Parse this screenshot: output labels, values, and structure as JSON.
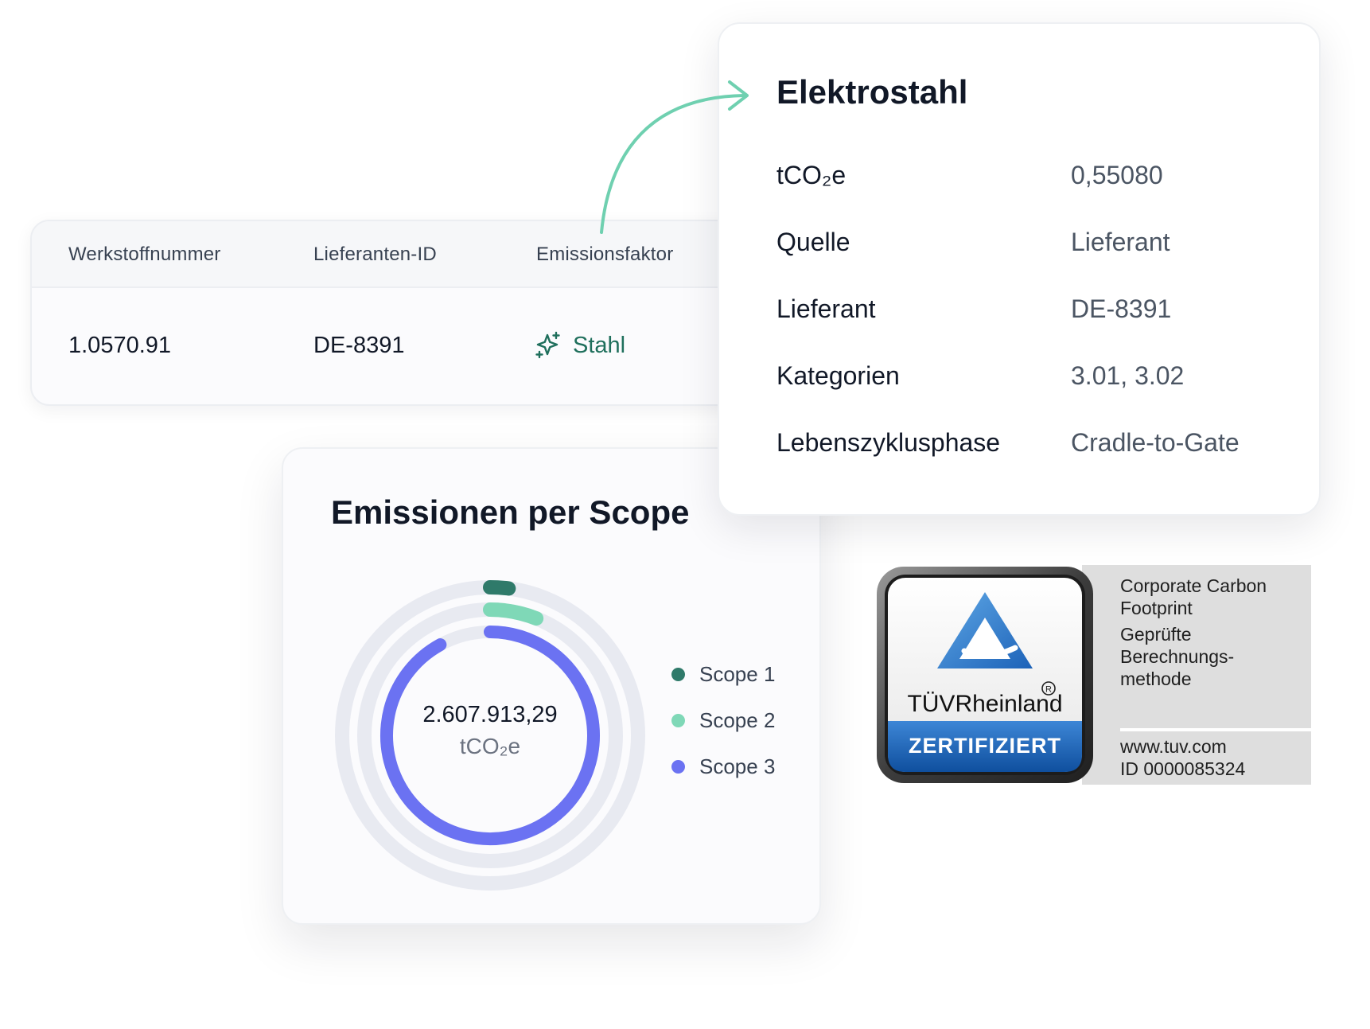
{
  "table": {
    "headers": [
      "Werkstoffnummer",
      "Lieferanten-ID",
      "Emissionsfaktor"
    ],
    "row": {
      "werkstoffnummer": "1.0570.91",
      "lieferanten_id": "DE-8391",
      "emissionsfaktor": "Stahl"
    },
    "icon": "sparkle-icon"
  },
  "detail": {
    "title": "Elektrostahl",
    "rows": [
      {
        "label": "tCO₂e",
        "value": "0,55080"
      },
      {
        "label": "Quelle",
        "value": "Lieferant"
      },
      {
        "label": "Lieferant",
        "value": "DE-8391"
      },
      {
        "label": "Kategorien",
        "value": "3.01, 3.02"
      },
      {
        "label": "Lebenszyklusphase",
        "value": "Cradle-to-Gate"
      }
    ]
  },
  "chart": {
    "title": "Emissionen per Scope",
    "total": "2.607.913,29",
    "unit": "tCO₂e"
  },
  "chart_data": {
    "type": "radial-bar",
    "title": "Emissionen per Scope",
    "series": [
      {
        "name": "Scope 1",
        "fraction": 0.02,
        "color": "#2f7a6a"
      },
      {
        "name": "Scope 2",
        "fraction": 0.06,
        "color": "#7fd8b7"
      },
      {
        "name": "Scope 3",
        "fraction": 0.92,
        "color": "#6b72f2"
      }
    ],
    "total": "2.607.913,29",
    "unit": "tCO₂e",
    "legend": "right"
  },
  "badge": {
    "brand": "TÜVRheinland",
    "stamp": "ZERTIFIZIERT",
    "line1": "Corporate Carbon",
    "line2": "Footprint",
    "line3": "Geprüfte",
    "line4": "Berechnungs-",
    "line5": "methode",
    "url": "www.tuv.com",
    "id": "ID  0000085324"
  },
  "colors": {
    "accent_green": "#6fd0b0",
    "stahl_text": "#1f6f5c",
    "scope1": "#2f7a6a",
    "scope2": "#7fd8b7",
    "scope3": "#6b72f2",
    "track": "#e8eaf1"
  }
}
